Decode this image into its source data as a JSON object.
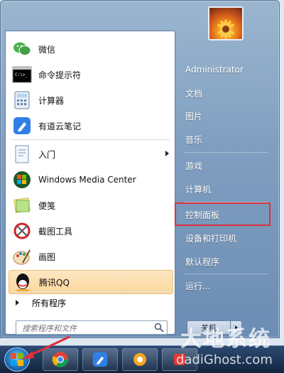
{
  "programs": [
    {
      "label": "微信",
      "icon": "wechat-icon"
    },
    {
      "label": "命令提示符",
      "icon": "cmd-icon"
    },
    {
      "label": "计算器",
      "icon": "calculator-icon"
    },
    {
      "label": "有道云笔记",
      "icon": "youdao-note-icon"
    },
    {
      "label": "入门",
      "icon": "getting-started-icon"
    },
    {
      "label": "Windows Media Center",
      "icon": "media-center-icon"
    },
    {
      "label": "便笺",
      "icon": "sticky-notes-icon"
    },
    {
      "label": "截图工具",
      "icon": "snipping-tool-icon"
    },
    {
      "label": "画图",
      "icon": "paint-icon"
    },
    {
      "label": "腾讯QQ",
      "icon": "qq-icon"
    }
  ],
  "all_programs": "所有程序",
  "search": {
    "placeholder": "搜索程序和文件"
  },
  "right_items": [
    {
      "label": "Administrator"
    },
    {
      "label": "文档"
    },
    {
      "label": "图片"
    },
    {
      "label": "音乐"
    },
    {
      "label": "游戏"
    },
    {
      "label": "计算机"
    },
    {
      "label": "控制面板"
    },
    {
      "label": "设备和打印机"
    },
    {
      "label": "默认程序"
    },
    {
      "label": "运行..."
    }
  ],
  "shutdown": "关机",
  "watermark": {
    "line1": "大地系统",
    "line2": "dadiGhost.com"
  },
  "colors": {
    "highlight": "#fbd79c",
    "annotation": "#e0303a"
  }
}
